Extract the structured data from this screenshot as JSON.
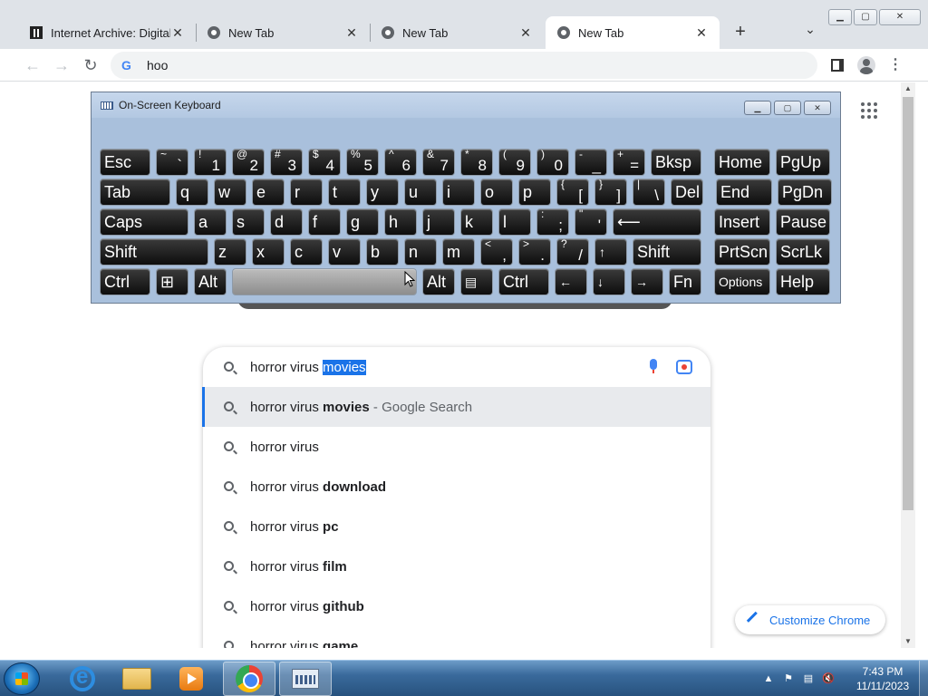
{
  "browser": {
    "tabs": [
      {
        "label": "Internet Archive: Digital",
        "icon": "internet-archive-icon",
        "active": false
      },
      {
        "label": "New Tab",
        "icon": "chrome-icon",
        "active": false
      },
      {
        "label": "New Tab",
        "icon": "chrome-icon",
        "active": false
      },
      {
        "label": "New Tab",
        "icon": "chrome-icon",
        "active": true
      }
    ],
    "new_tab_symbol": "+",
    "tab_list_symbol": "⌄",
    "tab_close_symbol": "✕",
    "address": "hoo",
    "address_icon": "G"
  },
  "search": {
    "query_plain": "horror virus ",
    "query_selected": "movies",
    "suggestions": [
      {
        "plain": "horror virus ",
        "bold": "movies",
        "hint": " - Google Search",
        "highlighted": true
      },
      {
        "plain": "horror virus",
        "bold": "",
        "hint": "",
        "highlighted": false
      },
      {
        "plain": "horror virus ",
        "bold": "download",
        "hint": "",
        "highlighted": false
      },
      {
        "plain": "horror virus ",
        "bold": "pc",
        "hint": "",
        "highlighted": false
      },
      {
        "plain": "horror virus ",
        "bold": "film",
        "hint": "",
        "highlighted": false
      },
      {
        "plain": "horror virus ",
        "bold": "github",
        "hint": "",
        "highlighted": false
      },
      {
        "plain": "horror virus ",
        "bold": "game",
        "hint": "",
        "highlighted": false
      }
    ]
  },
  "customize_label": "Customize Chrome",
  "osk": {
    "title": "On-Screen Keyboard",
    "rows": [
      [
        {
          "label": "Esc",
          "w": 58
        },
        {
          "up": "~",
          "dn": "`",
          "w": 38
        },
        {
          "up": "!",
          "dn": "1",
          "w": 38
        },
        {
          "up": "@",
          "dn": "2",
          "w": 38
        },
        {
          "up": "#",
          "dn": "3",
          "w": 38
        },
        {
          "up": "$",
          "dn": "4",
          "w": 38
        },
        {
          "up": "%",
          "dn": "5",
          "w": 38
        },
        {
          "up": "^",
          "dn": "6",
          "w": 38
        },
        {
          "up": "&",
          "dn": "7",
          "w": 38
        },
        {
          "up": "*",
          "dn": "8",
          "w": 38
        },
        {
          "up": "(",
          "dn": "9",
          "w": 38
        },
        {
          "up": ")",
          "dn": "0",
          "w": 38
        },
        {
          "up": "-",
          "dn": "_",
          "w": 38
        },
        {
          "up": "+",
          "dn": "=",
          "w": 38
        },
        {
          "label": "Bksp",
          "w": 58
        },
        {
          "label": "Home",
          "w": 64,
          "gap": 8
        },
        {
          "label": "PgUp",
          "w": 62
        }
      ],
      [
        {
          "label": "Tab",
          "w": 80
        },
        {
          "label": "q",
          "w": 38
        },
        {
          "label": "w",
          "w": 38
        },
        {
          "label": "e",
          "w": 38
        },
        {
          "label": "r",
          "w": 38
        },
        {
          "label": "t",
          "w": 38
        },
        {
          "label": "y",
          "w": 38
        },
        {
          "label": "u",
          "w": 38
        },
        {
          "label": "i",
          "w": 38
        },
        {
          "label": "o",
          "w": 38
        },
        {
          "label": "p",
          "w": 38
        },
        {
          "up": "{",
          "dn": "[",
          "w": 38
        },
        {
          "up": "}",
          "dn": "]",
          "w": 38
        },
        {
          "up": "|",
          "dn": "\\",
          "w": 38
        },
        {
          "label": "Del",
          "w": 38
        },
        {
          "label": "End",
          "w": 64,
          "gap": 8
        },
        {
          "label": "PgDn",
          "w": 62
        }
      ],
      [
        {
          "label": "Caps",
          "w": 100
        },
        {
          "label": "a",
          "w": 38
        },
        {
          "label": "s",
          "w": 38
        },
        {
          "label": "d",
          "w": 38
        },
        {
          "label": "f",
          "w": 38
        },
        {
          "label": "g",
          "w": 38
        },
        {
          "label": "h",
          "w": 38
        },
        {
          "label": "j",
          "w": 38
        },
        {
          "label": "k",
          "w": 38
        },
        {
          "label": "l",
          "w": 38
        },
        {
          "up": ":",
          "dn": ";",
          "w": 38
        },
        {
          "up": "\"",
          "dn": "'",
          "w": 38
        },
        {
          "label": "⟵",
          "w": 100
        },
        {
          "label": "Insert",
          "w": 64,
          "gap": 8
        },
        {
          "label": "Pause",
          "w": 62
        }
      ],
      [
        {
          "label": "Shift",
          "w": 122
        },
        {
          "label": "z",
          "w": 38
        },
        {
          "label": "x",
          "w": 38
        },
        {
          "label": "c",
          "w": 38
        },
        {
          "label": "v",
          "w": 38
        },
        {
          "label": "b",
          "w": 38
        },
        {
          "label": "n",
          "w": 38
        },
        {
          "label": "m",
          "w": 38
        },
        {
          "up": "<",
          "dn": ",",
          "w": 38
        },
        {
          "up": ">",
          "dn": ".",
          "w": 38
        },
        {
          "up": "?",
          "dn": "/",
          "w": 38
        },
        {
          "label": "↑",
          "w": 38,
          "small": true
        },
        {
          "label": "Shift",
          "w": 78
        },
        {
          "label": "PrtScn",
          "w": 64,
          "gap": 8
        },
        {
          "label": "ScrLk",
          "w": 62
        }
      ],
      [
        {
          "label": "Ctrl",
          "w": 58
        },
        {
          "label": "⊞",
          "w": 38
        },
        {
          "label": "Alt",
          "w": 38
        },
        {
          "label": "",
          "w": 206,
          "space": true
        },
        {
          "label": "Alt",
          "w": 38
        },
        {
          "label": "▤",
          "w": 38,
          "small": true
        },
        {
          "label": "Ctrl",
          "w": 58
        },
        {
          "label": "←",
          "w": 38,
          "small": true
        },
        {
          "label": "↓",
          "w": 38,
          "small": true
        },
        {
          "label": "→",
          "w": 38,
          "small": true
        },
        {
          "label": "Fn",
          "w": 38
        },
        {
          "label": "Options",
          "w": 64,
          "gap": 8,
          "small": true
        },
        {
          "label": "Help",
          "w": 62
        }
      ]
    ]
  },
  "taskbar": {
    "apps": [
      {
        "name": "internet-explorer-icon",
        "active": false
      },
      {
        "name": "file-explorer-icon",
        "active": false
      },
      {
        "name": "media-player-icon",
        "active": false
      },
      {
        "name": "chrome-icon",
        "active": true
      },
      {
        "name": "on-screen-keyboard-icon",
        "active": true
      }
    ],
    "time": "7:43 PM",
    "date": "11/11/2023"
  }
}
